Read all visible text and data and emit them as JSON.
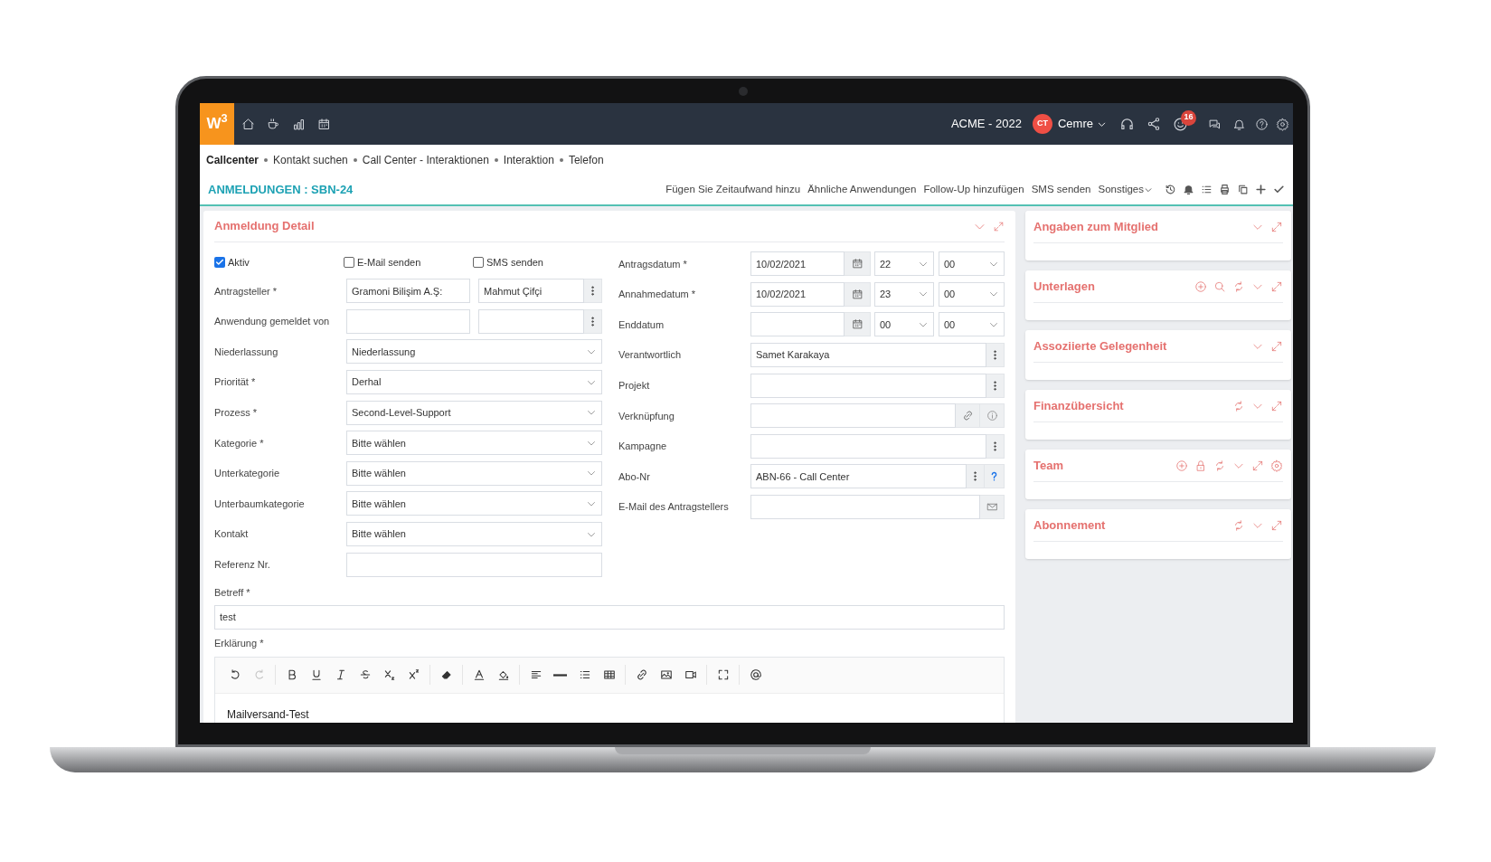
{
  "top_bar": {
    "logo": "W$^{3}$",
    "company": "ACME - 2022",
    "user": {
      "initials": "CT",
      "name": "Cemre"
    },
    "notification_count": "16"
  },
  "breadcrumb": [
    {
      "label": "Callcenter",
      "selected": true
    },
    {
      "label": "Kontakt suchen",
      "selected": false
    },
    {
      "label": "Call Center - Interaktionen",
      "selected": false
    },
    {
      "label": "Interaktion",
      "selected": false
    },
    {
      "label": "Telefon",
      "selected": false
    }
  ],
  "page_header": {
    "title": "ANMELDUNGEN : SBN-24",
    "actions": [
      "Fügen Sie Zeitaufwand hinzu",
      "Ähnliche Anwendungen",
      "Follow-Up hinzufügen",
      "SMS senden"
    ],
    "more_menu": "Sonstiges"
  },
  "detail_panel": {
    "title": "Anmeldung Detail",
    "checkboxes": [
      {
        "label": "Aktiv",
        "checked": true
      },
      {
        "label": "E-Mail senden",
        "checked": false
      },
      {
        "label": "SMS senden",
        "checked": false
      }
    ],
    "left_fields": [
      {
        "kind": "pair",
        "label": "Antragsteller *",
        "values": [
          "Gramoni Bilişim A.Ş:",
          "Mahmut Çifçi"
        ]
      },
      {
        "kind": "pair",
        "label": "Anwendung gemeldet von"
      },
      {
        "kind": "select",
        "label": "Niederlassung",
        "value": "Niederlassung"
      },
      {
        "kind": "select",
        "label": "Priorität *",
        "value": "Derhal"
      },
      {
        "kind": "select",
        "label": "Prozess *",
        "value": "Second-Level-Support"
      },
      {
        "kind": "select",
        "label": "Kategorie *",
        "value": "Bitte wählen"
      },
      {
        "kind": "select",
        "label": "Unterkategorie",
        "value": "Bitte wählen"
      },
      {
        "kind": "select",
        "label": "Unterbaumkategorie",
        "value": "Bitte wählen"
      },
      {
        "kind": "select",
        "label": "Kontakt",
        "value": "Bitte wählen"
      },
      {
        "kind": "text",
        "label": "Referenz Nr."
      }
    ],
    "right_fields": [
      {
        "kind": "date",
        "label": "Antragsdatum *",
        "date": "10/02/2021",
        "hour": "22",
        "minute": "00"
      },
      {
        "kind": "date",
        "label": "Annahmedatum *",
        "date": "10/02/2021",
        "hour": "23",
        "minute": "00"
      },
      {
        "kind": "date",
        "label": "Enddatum",
        "hour": "00",
        "minute": "00"
      },
      {
        "kind": "lookup",
        "label": "Verantwortlich",
        "value": "Samet Karakaya"
      },
      {
        "kind": "lookup",
        "label": "Projekt"
      },
      {
        "kind": "link",
        "label": "Verknüpfung"
      },
      {
        "kind": "lookup",
        "label": "Kampagne"
      },
      {
        "kind": "lookup-help",
        "label": "Abo-Nr",
        "value": "ABN-66 - Call Center"
      },
      {
        "kind": "email",
        "label": "E-Mail des Antragstellers"
      }
    ],
    "subject": {
      "label": "Betreff *",
      "value": "test"
    },
    "description": {
      "label": "Erklärung *",
      "text": "Mailversand-Test",
      "toolbar": [
        [
          {
            "kind": "undo",
            "disabled": false
          },
          {
            "kind": "redo",
            "disabled": true
          }
        ],
        [
          {
            "kind": "bold",
            "disabled": false
          },
          {
            "kind": "underline",
            "disabled": false
          },
          {
            "kind": "italic",
            "disabled": false
          },
          {
            "kind": "strikethrough",
            "disabled": false
          },
          {
            "kind": "subscript",
            "disabled": false
          },
          {
            "kind": "superscript",
            "disabled": false
          }
        ],
        [
          {
            "kind": "eraser",
            "disabled": false
          }
        ],
        [
          {
            "kind": "text-color",
            "disabled": false
          },
          {
            "kind": "fill-color",
            "disabled": false
          }
        ],
        [
          {
            "kind": "align",
            "disabled": false
          },
          {
            "kind": "rule",
            "disabled": false
          },
          {
            "kind": "list",
            "disabled": false
          },
          {
            "kind": "table",
            "disabled": false
          }
        ],
        [
          {
            "kind": "link",
            "disabled": false
          },
          {
            "kind": "image",
            "disabled": false
          },
          {
            "kind": "video",
            "disabled": false
          }
        ],
        [
          {
            "kind": "fullscreen",
            "disabled": false
          }
        ],
        [
          {
            "kind": "mention",
            "disabled": false
          }
        ]
      ]
    }
  },
  "side_panels": [
    {
      "title": "Angaben zum Mitglied",
      "tools": [
        {
          "kind": "collapse"
        },
        {
          "kind": "expand"
        }
      ]
    },
    {
      "title": "Unterlagen",
      "tools": [
        {
          "kind": "add"
        },
        {
          "kind": "search"
        },
        {
          "kind": "refresh"
        },
        {
          "kind": "collapse"
        },
        {
          "kind": "expand"
        }
      ]
    },
    {
      "title": "Assoziierte Gelegenheit",
      "tools": [
        {
          "kind": "collapse"
        },
        {
          "kind": "expand"
        }
      ]
    },
    {
      "title": "Finanzübersicht",
      "tools": [
        {
          "kind": "refresh"
        },
        {
          "kind": "collapse"
        },
        {
          "kind": "expand"
        }
      ]
    },
    {
      "title": "Team",
      "tools": [
        {
          "kind": "add"
        },
        {
          "kind": "lock"
        },
        {
          "kind": "refresh"
        },
        {
          "kind": "collapse"
        },
        {
          "kind": "expand"
        },
        {
          "kind": "settings"
        }
      ]
    },
    {
      "title": "Abonnement",
      "tools": [
        {
          "kind": "refresh"
        },
        {
          "kind": "collapse"
        },
        {
          "kind": "expand"
        }
      ]
    }
  ]
}
